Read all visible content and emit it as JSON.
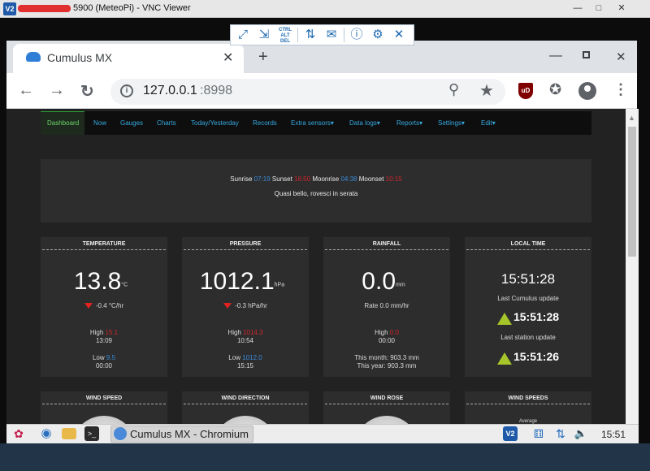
{
  "vnc": {
    "title": "5900 (MeteoPi) - VNC Viewer",
    "logo": "V2",
    "toolbar_icons": [
      "fullscreen-icon",
      "scale-icon",
      "ctrl-alt-del-icon",
      "transfer-icon",
      "chat-icon",
      "info-icon",
      "settings-icon",
      "close-icon"
    ],
    "cad_label": "CTRL ALT DEL"
  },
  "browser": {
    "tab_title": "Cumulus MX",
    "url_host": "127.0.0.1",
    "url_port": ":8998",
    "ublock_label": "uD"
  },
  "nav": {
    "items": [
      "Dashboard",
      "Now",
      "Gauges",
      "Charts",
      "Today/Yesterday",
      "Records",
      "Extra sensors▾",
      "Data logs▾",
      "Reports▾",
      "Settings▾",
      "Edit▾"
    ]
  },
  "banner": {
    "sunrise_label": "Sunrise",
    "sunrise": "07:19",
    "sunset_label": "Sunset",
    "sunset": "16:50",
    "moonrise_label": "Moonrise",
    "moonrise": "04:38",
    "moonset_label": "Moonset",
    "moonset": "10:15",
    "forecast": "Quasi bello, rovesci in serata"
  },
  "panels": {
    "temperature": {
      "title": "TEMPERATURE",
      "value": "13.8",
      "unit": "°C",
      "trend": "-0.4 °C/hr",
      "high_label": "High",
      "high": "15.1",
      "high_time": "13:09",
      "low_label": "Low",
      "low": "9.5",
      "low_time": "00:00"
    },
    "pressure": {
      "title": "PRESSURE",
      "value": "1012.1",
      "unit": "hPa",
      "trend": "-0.3 hPa/hr",
      "high_label": "High",
      "high": "1014.3",
      "high_time": "10:54",
      "low_label": "Low",
      "low": "1012.0",
      "low_time": "15:15"
    },
    "rainfall": {
      "title": "RAINFALL",
      "value": "0.0",
      "unit": "mm",
      "rate": "Rate 0.0 mm/hr",
      "high_label": "High",
      "high": "0.0",
      "high_time": "00:00",
      "month": "This month: 903.3 mm",
      "year": "This year: 903.3 mm"
    },
    "local_time": {
      "title": "LOCAL TIME",
      "time": "15:51:28",
      "cumulus_label": "Last Cumulus update",
      "cumulus_time": "15:51:28",
      "station_label": "Last station update",
      "station_time": "15:51:26"
    },
    "row2_titles": [
      "WIND SPEED",
      "WIND DIRECTION",
      "WIND ROSE",
      "WIND SPEEDS"
    ],
    "wind_speeds_partial": "Average"
  },
  "taskbar": {
    "task_label": "Cumulus MX - Chromium",
    "clock": "15:51"
  },
  "colors": {
    "accent_blue": "#3a8bd8",
    "accent_red": "#d0262c",
    "nav_link": "#35a9e0",
    "trend_up": "#a6c52a"
  }
}
